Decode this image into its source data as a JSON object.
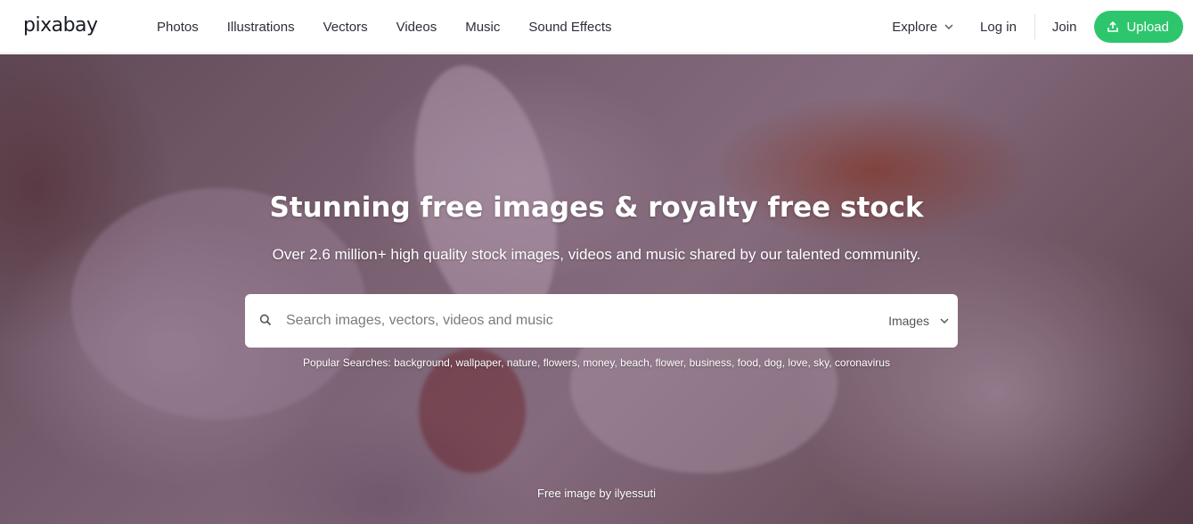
{
  "header": {
    "logo": "pixabay",
    "nav": [
      "Photos",
      "Illustrations",
      "Vectors",
      "Videos",
      "Music",
      "Sound Effects"
    ],
    "explore_label": "Explore",
    "login_label": "Log in",
    "join_label": "Join",
    "upload_label": "Upload"
  },
  "hero": {
    "headline": "Stunning free images & royalty free stock",
    "subline": "Over 2.6 million+ high quality stock images, videos and music shared by our talented community.",
    "search": {
      "placeholder": "Search images, vectors, videos and music",
      "value": "",
      "type_selected": "Images"
    },
    "popular": {
      "label": "Popular Searches:",
      "tags": [
        "background",
        "wallpaper",
        "nature",
        "flowers",
        "money",
        "beach",
        "flower",
        "business",
        "food",
        "dog",
        "love",
        "sky",
        "coronavirus"
      ]
    },
    "credit": "Free image by ilyessuti"
  },
  "colors": {
    "accent": "#2ec66d",
    "text": "#2c2f3a"
  },
  "icons": {
    "search": "search-icon",
    "explore_chevron": "chevron-down-icon",
    "type_chevron": "chevron-down-icon",
    "upload": "upload-icon"
  }
}
